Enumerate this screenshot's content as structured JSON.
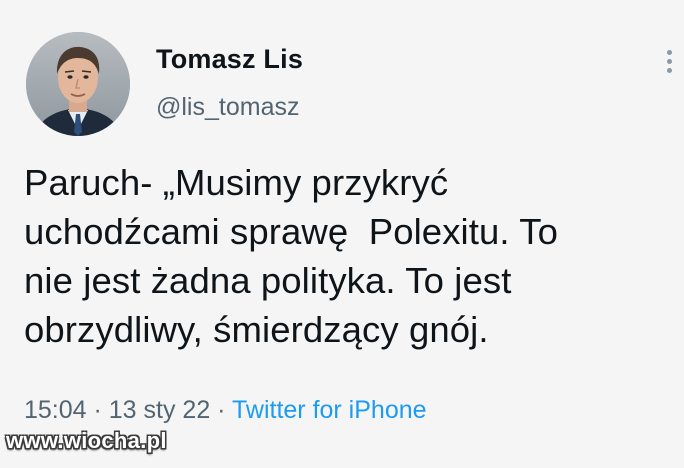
{
  "tweet": {
    "author_name": "Tomasz Lis",
    "handle": "@lis_tomasz",
    "text": "Paruch- „Musimy przykryć\nuchodźcami sprawę  Polexitu. To\nnie jest żadna polityka. To jest\nobrzydliwy, śmierdzący gnój.",
    "time": "15:04",
    "separator": " · ",
    "date": "13 sty 22",
    "source": "Twitter for iPhone",
    "more_icon": "more-vertical-icon",
    "avatar_icon": "profile-photo"
  },
  "watermark": {
    "text": "www.wiocha.pl"
  },
  "colors": {
    "background": "#f5f5f5",
    "text": "#0f1419",
    "secondary": "#536471",
    "link": "#1d9bf0"
  }
}
